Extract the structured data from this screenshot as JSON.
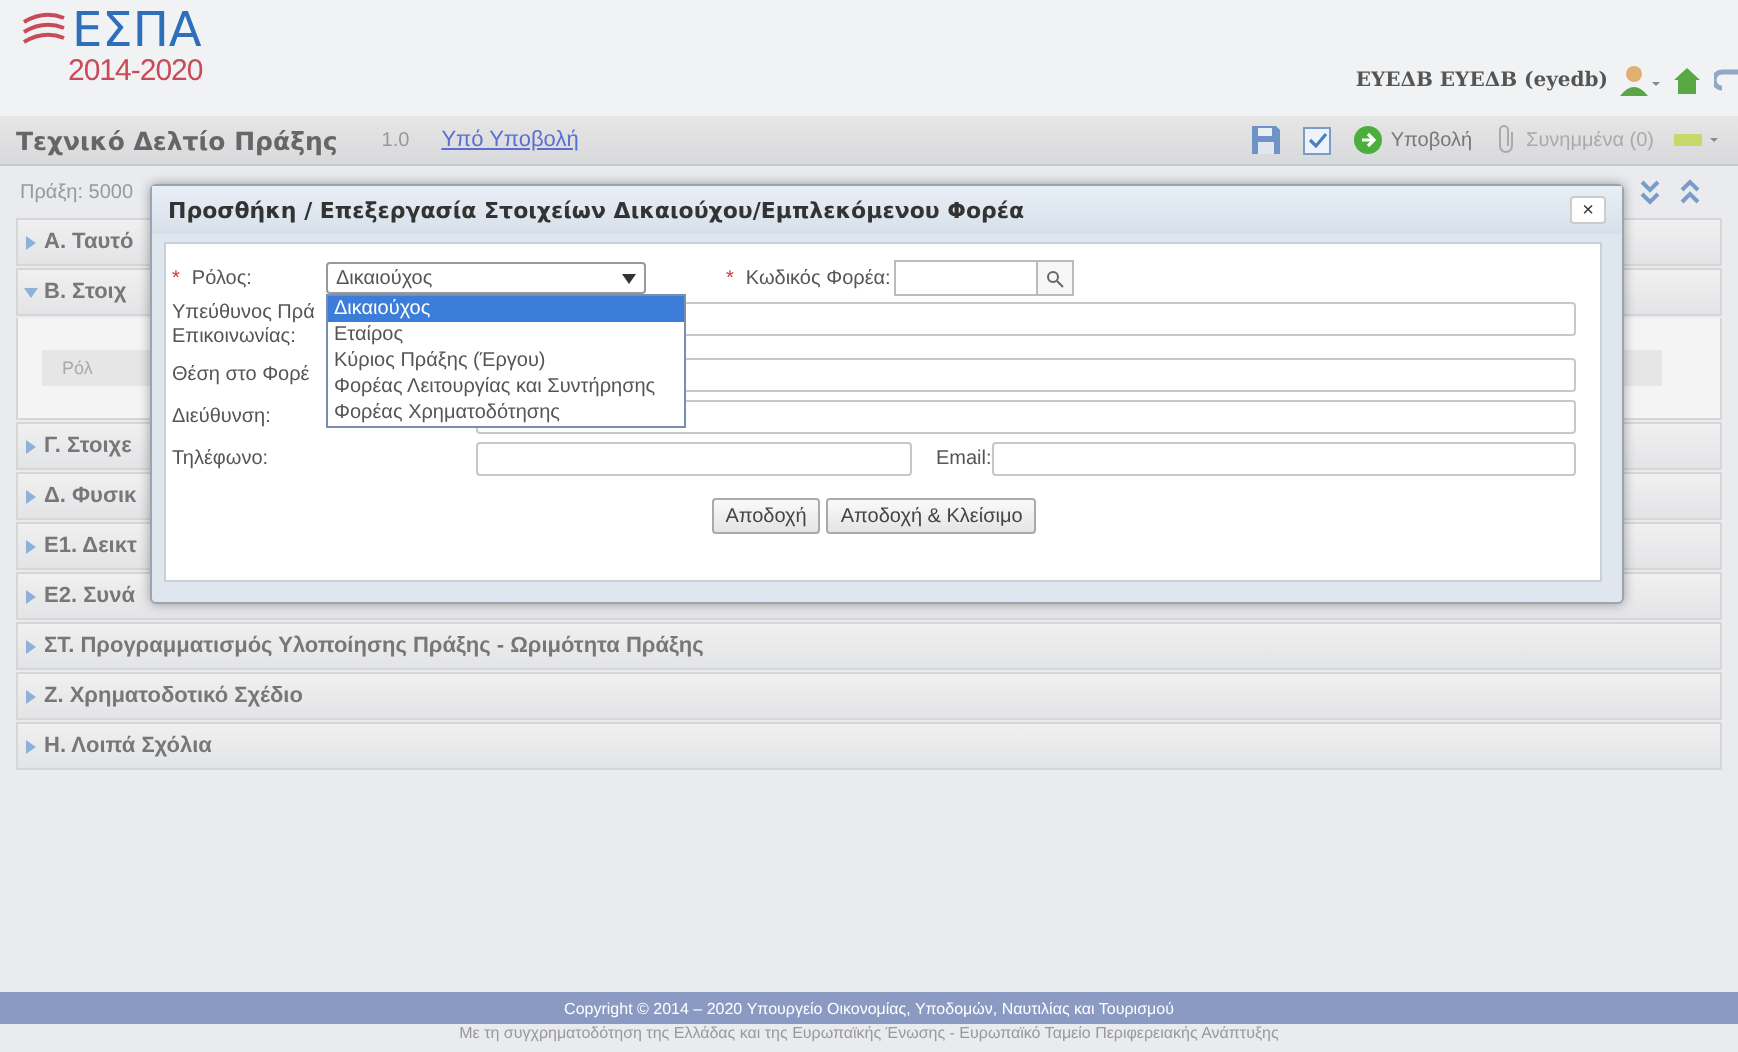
{
  "logo": {
    "title": "ΕΣΠΑ",
    "years": "2014-2020"
  },
  "header": {
    "user": "ΕΥΕΔΒ ΕΥΕΔΒ (eyedb)"
  },
  "title_bar": {
    "title": "Τεχνικό Δελτίο Πράξης",
    "version": "1.0",
    "status": "Υπό Υποβολή",
    "actions": [
      {
        "kind": "save"
      },
      {
        "kind": "check"
      },
      {
        "kind": "submit",
        "label": "Υποβολή",
        "disabled": false
      },
      {
        "kind": "attachments",
        "label": "Συνημμένα (0)",
        "disabled": true
      },
      {
        "kind": "language"
      }
    ]
  },
  "project_label": "Πράξη: 5000",
  "sections": [
    {
      "label": "Α. Ταυτό",
      "expanded": false
    },
    {
      "label": "Β. Στοιχ",
      "expanded": true,
      "column_1": "Ρόλ"
    },
    {
      "label": "Γ. Στοιχε",
      "expanded": false
    },
    {
      "label": "Δ. Φυσικ",
      "expanded": false
    },
    {
      "label": "Ε1. Δεικτ",
      "expanded": false
    },
    {
      "label": "Ε2. Συνά",
      "expanded": false
    },
    {
      "label": "ΣΤ. Προγραμματισμός Υλοποίησης Πράξης - Ωριμότητα Πράξης",
      "expanded": false
    },
    {
      "label": "Ζ. Χρηματοδοτικό Σχέδιο",
      "expanded": false
    },
    {
      "label": "Η. Λοιπά Σχόλια",
      "expanded": false
    }
  ],
  "dialog": {
    "title": "Προσθήκη / Επεξεργασία Στοιχείων Δικαιούχου/Εμπλεκόμενου Φορέα",
    "close": "×",
    "required_marker": "*",
    "role": {
      "label": "Ρόλος:",
      "required": true,
      "value": "Δικαιούχος",
      "expanded": true,
      "options": [
        {
          "label": "Δικαιούχος",
          "selected": true
        },
        {
          "label": "Εταίρος",
          "selected": false
        },
        {
          "label": "Κύριος Πράξης (Έργου)",
          "selected": false
        },
        {
          "label": "Φορέας Λειτουργίας και Συντήρησης",
          "selected": false
        },
        {
          "label": "Φορέας Χρηματοδότησης",
          "selected": false
        }
      ]
    },
    "code": {
      "label": "Κωδικός Φορέα:",
      "required": true
    },
    "responsible": {
      "label_lines": [
        "Υπεύθυνος Πρά",
        "Επικοινωνίας:"
      ]
    },
    "position": {
      "label": "Θέση στο Φορέ"
    },
    "address": {
      "label": "Διεύθυνση:"
    },
    "phone": {
      "label": "Τηλέφωνο:"
    },
    "email": {
      "label": "Email:"
    },
    "buttons": [
      "Αποδοχή",
      "Αποδοχή & Κλείσιμο"
    ]
  },
  "footer": {
    "copyright": "Copyright © 2014 – 2020 Υπουργείο Οικονομίας, Υποδομών, Ναυτιλίας και Τουρισμού",
    "cofunding": "Με τη συγχρηματοδότηση της Ελλάδας και της Ευρωπαϊκής Ένωσης - Ευρωπαϊκό Ταμείο Περιφερειακής Ανάπτυξης"
  }
}
